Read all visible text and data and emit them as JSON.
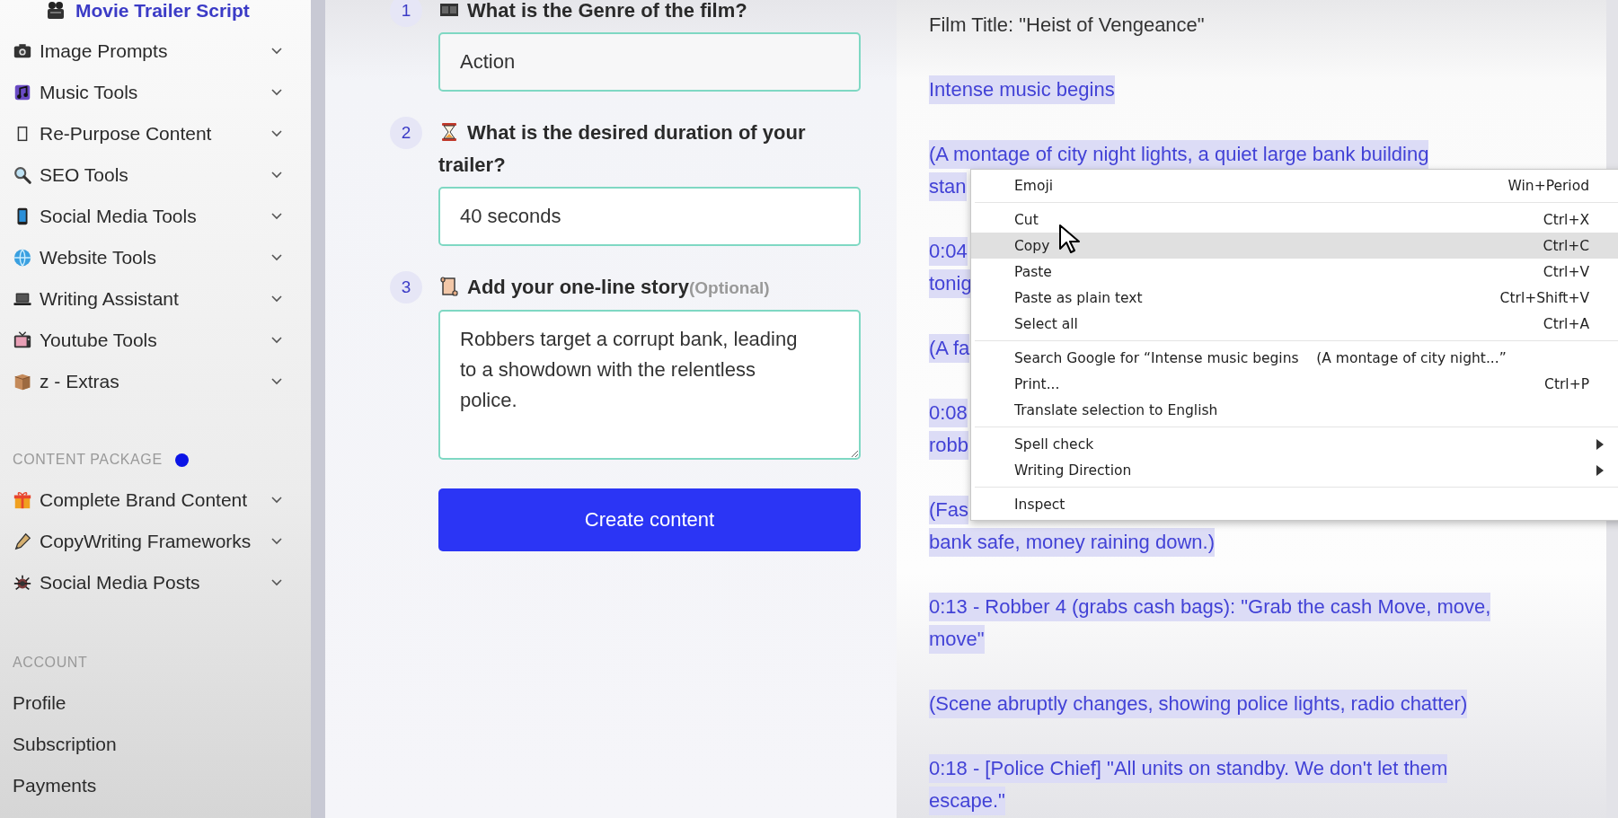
{
  "sidebar": {
    "current_item": {
      "label": "Movie Trailer Script"
    },
    "tool_groups": [
      {
        "label": "Image Prompts"
      },
      {
        "label": "Music Tools"
      },
      {
        "label": "Re-Purpose Content"
      },
      {
        "label": "SEO Tools"
      },
      {
        "label": "Social Media Tools"
      },
      {
        "label": "Website Tools"
      },
      {
        "label": "Writing Assistant"
      },
      {
        "label": "Youtube Tools"
      },
      {
        "label": "z - Extras"
      }
    ],
    "package_section": {
      "heading": "CONTENT PACKAGE",
      "has_indicator": true,
      "items": [
        {
          "label": "Complete Brand Content"
        },
        {
          "label": "CopyWriting Frameworks"
        },
        {
          "label": "Social Media Posts"
        }
      ]
    },
    "account_section": {
      "heading": "ACCOUNT",
      "links": [
        "Profile",
        "Subscription",
        "Payments"
      ]
    }
  },
  "form": {
    "steps": [
      {
        "number": "1",
        "label": "What is the Genre of the film?",
        "kind": "input",
        "value": "Action"
      },
      {
        "number": "2",
        "label": "What is the desired duration of your trailer?",
        "kind": "input",
        "value": "40 seconds"
      },
      {
        "number": "3",
        "label": "Add your one-line story",
        "optional": "(Optional)",
        "kind": "textarea",
        "value": "Robbers target a corrupt bank, leading to a showdown with the relentless police."
      }
    ],
    "submit": "Create content"
  },
  "output": {
    "paragraphs": [
      {
        "selected": false,
        "lines": [
          "Film Title: \"Heist of Vengeance\""
        ]
      },
      {
        "selected": true,
        "lines": [
          "Intense music begins"
        ]
      },
      {
        "selected": true,
        "lines": [
          "(A montage of city night lights, a quiet large bank building",
          "stan"
        ]
      },
      {
        "selected": true,
        "lines": [
          "0:04",
          "tonig"
        ]
      },
      {
        "selected": true,
        "lines": [
          "(A fa"
        ]
      },
      {
        "selected": true,
        "lines": [
          "0:08",
          "robb"
        ]
      },
      {
        "selected": true,
        "lines": [
          "(Fas",
          "bank safe, money raining down.)"
        ]
      },
      {
        "selected": true,
        "lines": [
          "0:13 - Robber 4 (grabs cash bags): \"Grab the cash Move, move,",
          "move\""
        ]
      },
      {
        "selected": true,
        "lines": [
          "(Scene abruptly changes, showing police lights, radio chatter)"
        ]
      },
      {
        "selected": true,
        "lines": [
          "0:18 - [Police Chief] \"All units on standby. We don't let them",
          "escape.\""
        ]
      }
    ]
  },
  "context_menu": {
    "groups": [
      [
        {
          "label": "Emoji",
          "shortcut": "Win+Period",
          "selected": false
        }
      ],
      [
        {
          "label": "Cut",
          "shortcut": "Ctrl+X",
          "selected": false
        },
        {
          "label": "Copy",
          "shortcut": "Ctrl+C",
          "selected": true
        },
        {
          "label": "Paste",
          "shortcut": "Ctrl+V",
          "selected": false
        },
        {
          "label": "Paste as plain text",
          "shortcut": "Ctrl+Shift+V",
          "selected": false
        },
        {
          "label": "Select all",
          "shortcut": "Ctrl+A",
          "selected": false
        }
      ],
      [
        {
          "label": "Search Google for “Intense music begins    (A montage of city night...”",
          "selected": false
        },
        {
          "label": "Print...",
          "shortcut": "Ctrl+P",
          "selected": false
        },
        {
          "label": "Translate selection to English",
          "selected": false
        }
      ],
      [
        {
          "label": "Spell check",
          "submenu": true,
          "selected": false
        },
        {
          "label": "Writing Direction",
          "submenu": true,
          "selected": false
        }
      ],
      [
        {
          "label": "Inspect",
          "selected": false
        }
      ]
    ]
  }
}
